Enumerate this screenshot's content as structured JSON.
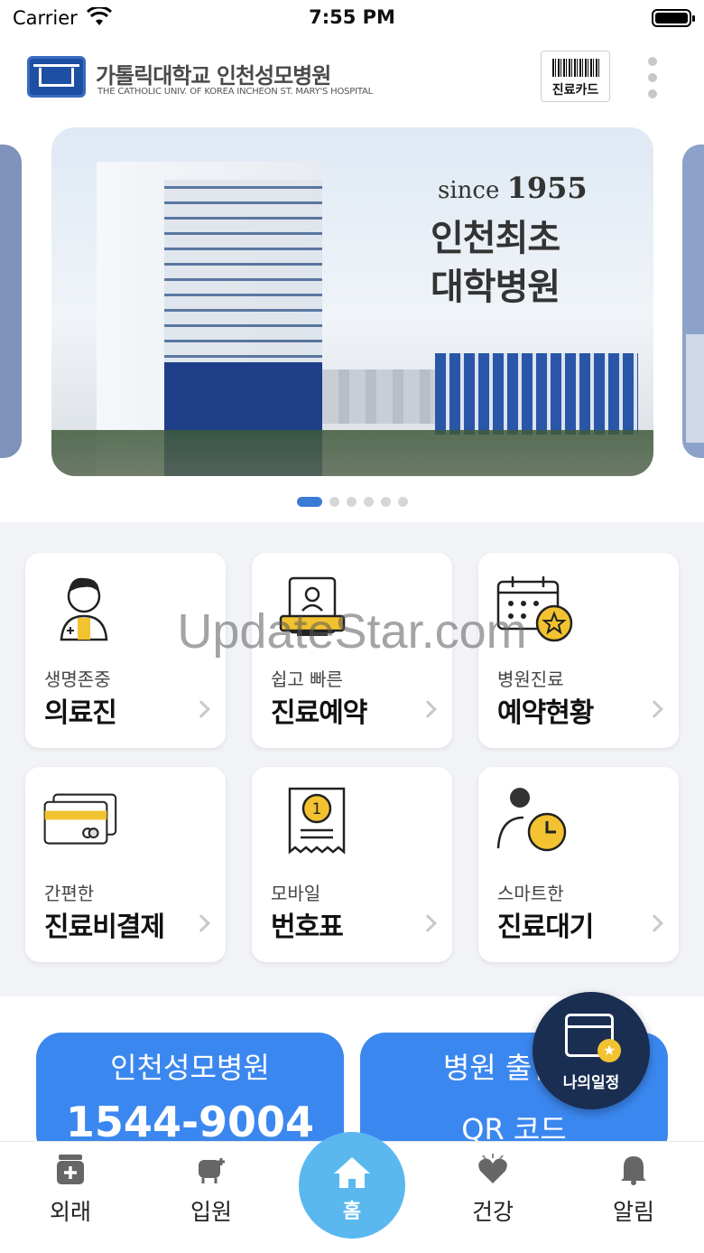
{
  "status_bar": {
    "carrier": "Carrier",
    "time": "7:55 PM"
  },
  "header": {
    "hospital_name": "가톨릭대학교 인천성모병원",
    "hospital_name_en": "THE CATHOLIC UNIV. OF KOREA INCHEON ST. MARY'S HOSPITAL",
    "card_button": "진료카드"
  },
  "banner": {
    "since_word": "since",
    "since_year": "1955",
    "line1": "인천최초",
    "line2": "대학병원",
    "slides_total": 6,
    "active_slide": 1
  },
  "menu": {
    "items": [
      {
        "sub": "생명존중",
        "main": "의료진",
        "icon": "doctor-icon"
      },
      {
        "sub": "쉽고 빠른",
        "main": "진료예약",
        "icon": "reservation-icon"
      },
      {
        "sub": "병원진료",
        "main": "예약현황",
        "icon": "calendar-star-icon"
      },
      {
        "sub": "간편한",
        "main": "진료비결제",
        "icon": "credit-card-icon"
      },
      {
        "sub": "모바일",
        "main": "번호표",
        "icon": "ticket-number-icon"
      },
      {
        "sub": "스마트한",
        "main": "진료대기",
        "icon": "waiting-clock-icon"
      }
    ]
  },
  "watermark": "UpdateStar.com",
  "cta": {
    "phone_title": "인천성모병원",
    "phone_number": "1544-9004",
    "qr_title": "병원 출입용",
    "qr_sub": "QR 코드"
  },
  "fab": {
    "label": "나의일정"
  },
  "tabbar": {
    "tabs": [
      {
        "label": "외래",
        "icon": "outpatient-icon"
      },
      {
        "label": "입원",
        "icon": "inpatient-icon"
      },
      {
        "label": "홈",
        "icon": "home-icon"
      },
      {
        "label": "건강",
        "icon": "health-heart-icon"
      },
      {
        "label": "알림",
        "icon": "bell-icon"
      }
    ]
  },
  "colors": {
    "accent": "#3b87f0",
    "home_tab": "#5ab8ef",
    "icon_yellow": "#f2c230",
    "fab_bg": "#1a2e52"
  }
}
